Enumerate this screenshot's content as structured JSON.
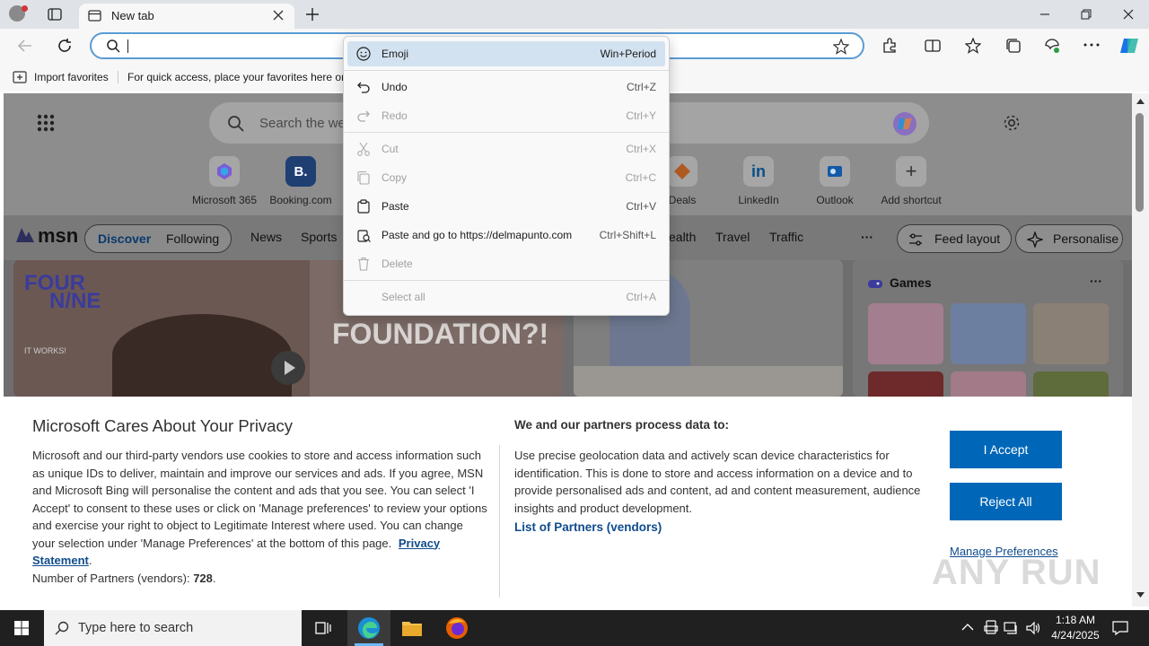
{
  "browser": {
    "tab_title": "New tab",
    "address_value": "",
    "favorites_bar": {
      "import_label": "Import favorites",
      "hint": "For quick access, place your favorites here on"
    }
  },
  "new_tab": {
    "search_placeholder": "Search the we",
    "shortcuts": [
      {
        "label": "Microsoft 365"
      },
      {
        "label": "Booking.com",
        "icon_text": "B."
      },
      {
        "label": "Deals"
      },
      {
        "label": "LinkedIn",
        "icon_text": "in"
      },
      {
        "label": "Outlook"
      },
      {
        "label": "Add shortcut",
        "icon_text": "+"
      }
    ],
    "msn": {
      "brand": "msn",
      "tabs": [
        "Discover",
        "Following"
      ],
      "nav": [
        "News",
        "Sports",
        "ealth",
        "Travel",
        "Traffic"
      ],
      "more": "···",
      "feed_layout": "Feed layout",
      "personalise": "Personalise"
    },
    "cards": {
      "video_headline": "FOUNDATION?!",
      "brand_line1": "FOUR",
      "brand_line2": "N/NE",
      "brand_sub": "IT WORKS!",
      "games_title": "Games",
      "games_more": "···"
    }
  },
  "context_menu": {
    "items": [
      {
        "label": "Emoji",
        "shortcut": "Win+Period",
        "icon": "emoji-icon",
        "enabled": true,
        "highlighted": true
      },
      {
        "label": "Undo",
        "shortcut": "Ctrl+Z",
        "icon": "undo-icon",
        "enabled": true
      },
      {
        "label": "Redo",
        "shortcut": "Ctrl+Y",
        "icon": "redo-icon",
        "enabled": false
      },
      {
        "label": "Cut",
        "shortcut": "Ctrl+X",
        "icon": "cut-icon",
        "enabled": false
      },
      {
        "label": "Copy",
        "shortcut": "Ctrl+C",
        "icon": "copy-icon",
        "enabled": false
      },
      {
        "label": "Paste",
        "shortcut": "Ctrl+V",
        "icon": "paste-icon",
        "enabled": true
      },
      {
        "label": "Paste and go to https://delmapunto.com",
        "shortcut": "Ctrl+Shift+L",
        "icon": "paste-go-icon",
        "enabled": true
      },
      {
        "label": "Delete",
        "shortcut": "",
        "icon": "delete-icon",
        "enabled": false
      },
      {
        "label": "Select all",
        "shortcut": "Ctrl+A",
        "icon": "",
        "enabled": false
      }
    ]
  },
  "privacy": {
    "title": "Microsoft Cares About Your Privacy",
    "body": "Microsoft and our third-party vendors use cookies to store and access information such as unique IDs to deliver, maintain and improve our services and ads. If you agree, MSN and Microsoft Bing will personalise the content and ads that you see. You can select 'I Accept' to consent to these uses or click on 'Manage preferences' to review your options and exercise your right to object to Legitimate Interest where used.  You can change your selection under 'Manage Preferences' at the bottom of this page.",
    "privacy_link": "Privacy Statement",
    "partners_label": "Number of Partners (vendors):",
    "partners_count": "728",
    "process_title": "We and our partners process data to:",
    "process_body": "Use precise geolocation data and actively scan device characteristics for identification. This is done to store and access information on a device and to provide personalised ads and content, ad and content measurement, audience insights and product development.",
    "partners_link": "List of Partners (vendors)",
    "accept": "I Accept",
    "reject": "Reject All",
    "manage": "Manage Preferences"
  },
  "taskbar": {
    "search_placeholder": "Type here to search",
    "time": "1:18 AM",
    "date": "4/24/2025"
  },
  "watermark": "ANY RUN",
  "colors": {
    "accent": "#0067b8",
    "address_focus": "#5b9bd5",
    "menu_highlight": "#d3e2f0"
  }
}
